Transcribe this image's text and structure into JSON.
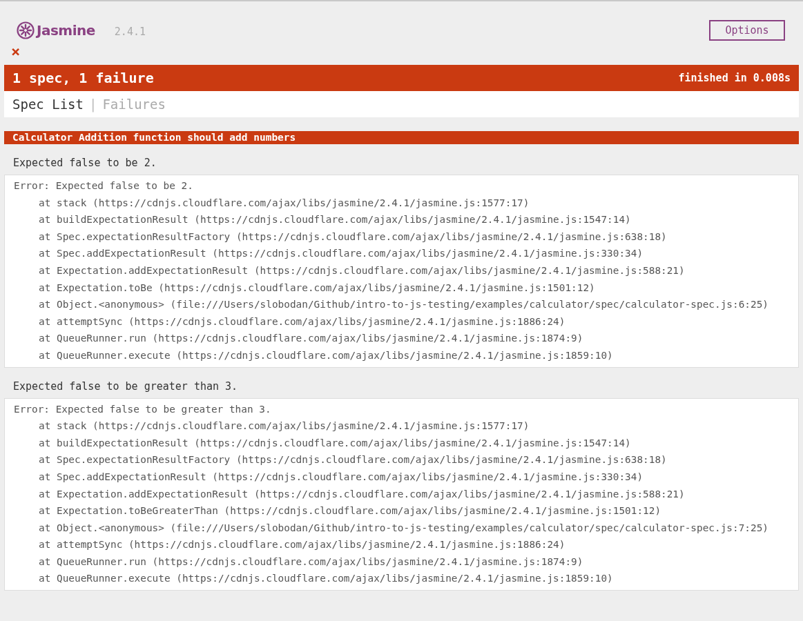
{
  "banner": {
    "logo_text": "Jasmine",
    "version": "2.4.1",
    "options_button": "Options"
  },
  "status_icon": {
    "kind": "failed",
    "symbol": "×"
  },
  "summary": {
    "text": "1 spec, 1 failure",
    "duration": "finished in 0.008s",
    "kind": "failed"
  },
  "menu": [
    {
      "label": "Spec List",
      "selected": false
    },
    {
      "label": "Failures",
      "selected": true
    }
  ],
  "menu_separator": "|",
  "failures": [
    {
      "title": "Calculator Addition function should add numbers",
      "expectations": [
        {
          "message": "Expected false to be 2.",
          "error": "Error: Expected false to be 2.",
          "frames": [
            "at stack (https://cdnjs.cloudflare.com/ajax/libs/jasmine/2.4.1/jasmine.js:1577:17)",
            "at buildExpectationResult (https://cdnjs.cloudflare.com/ajax/libs/jasmine/2.4.1/jasmine.js:1547:14)",
            "at Spec.expectationResultFactory (https://cdnjs.cloudflare.com/ajax/libs/jasmine/2.4.1/jasmine.js:638:18)",
            "at Spec.addExpectationResult (https://cdnjs.cloudflare.com/ajax/libs/jasmine/2.4.1/jasmine.js:330:34)",
            "at Expectation.addExpectationResult (https://cdnjs.cloudflare.com/ajax/libs/jasmine/2.4.1/jasmine.js:588:21)",
            "at Expectation.toBe (https://cdnjs.cloudflare.com/ajax/libs/jasmine/2.4.1/jasmine.js:1501:12)",
            "at Object.<anonymous> (file:///Users/slobodan/Github/intro-to-js-testing/examples/calculator/spec/calculator-spec.js:6:25)",
            "at attemptSync (https://cdnjs.cloudflare.com/ajax/libs/jasmine/2.4.1/jasmine.js:1886:24)",
            "at QueueRunner.run (https://cdnjs.cloudflare.com/ajax/libs/jasmine/2.4.1/jasmine.js:1874:9)",
            "at QueueRunner.execute (https://cdnjs.cloudflare.com/ajax/libs/jasmine/2.4.1/jasmine.js:1859:10)"
          ]
        },
        {
          "message": "Expected false to be greater than 3.",
          "error": "Error: Expected false to be greater than 3.",
          "frames": [
            "at stack (https://cdnjs.cloudflare.com/ajax/libs/jasmine/2.4.1/jasmine.js:1577:17)",
            "at buildExpectationResult (https://cdnjs.cloudflare.com/ajax/libs/jasmine/2.4.1/jasmine.js:1547:14)",
            "at Spec.expectationResultFactory (https://cdnjs.cloudflare.com/ajax/libs/jasmine/2.4.1/jasmine.js:638:18)",
            "at Spec.addExpectationResult (https://cdnjs.cloudflare.com/ajax/libs/jasmine/2.4.1/jasmine.js:330:34)",
            "at Expectation.addExpectationResult (https://cdnjs.cloudflare.com/ajax/libs/jasmine/2.4.1/jasmine.js:588:21)",
            "at Expectation.toBeGreaterThan (https://cdnjs.cloudflare.com/ajax/libs/jasmine/2.4.1/jasmine.js:1501:12)",
            "at Object.<anonymous> (file:///Users/slobodan/Github/intro-to-js-testing/examples/calculator/spec/calculator-spec.js:7:25)",
            "at attemptSync (https://cdnjs.cloudflare.com/ajax/libs/jasmine/2.4.1/jasmine.js:1886:24)",
            "at QueueRunner.run (https://cdnjs.cloudflare.com/ajax/libs/jasmine/2.4.1/jasmine.js:1874:9)",
            "at QueueRunner.execute (https://cdnjs.cloudflare.com/ajax/libs/jasmine/2.4.1/jasmine.js:1859:10)"
          ]
        }
      ]
    }
  ]
}
